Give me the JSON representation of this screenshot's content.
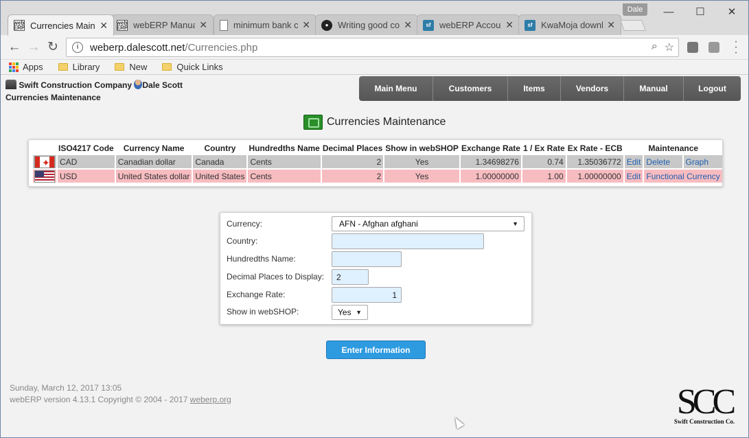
{
  "browser": {
    "tabs": [
      {
        "label": "Currencies Main",
        "icon": "weberp-icon",
        "active": true
      },
      {
        "label": "webERP Manual",
        "icon": "weberp-icon",
        "active": false
      },
      {
        "label": "minimum bank c",
        "icon": "document-icon",
        "active": false
      },
      {
        "label": "Writing good co",
        "icon": "github-icon",
        "active": false
      },
      {
        "label": "webERP Accoun",
        "icon": "sourceforge-icon",
        "active": false
      },
      {
        "label": "KwaMoja downl",
        "icon": "sourceforge-icon",
        "active": false
      }
    ],
    "profile_name": "Dale",
    "url_host": "weberp.dalescott.net",
    "url_path": "/Currencies.php",
    "bookmarks": [
      {
        "label": "Apps",
        "icon": "apps-grid-icon"
      },
      {
        "label": "Library",
        "icon": "folder-icon"
      },
      {
        "label": "New",
        "icon": "folder-icon"
      },
      {
        "label": "Quick Links",
        "icon": "folder-icon"
      }
    ]
  },
  "header": {
    "company": "Swift Construction Company",
    "user": "Dale Scott",
    "section": "Currencies Maintenance"
  },
  "nav": [
    {
      "label": "Main Menu"
    },
    {
      "label": "Customers"
    },
    {
      "label": "Items"
    },
    {
      "label": "Vendors"
    },
    {
      "label": "Manual"
    },
    {
      "label": "Logout"
    }
  ],
  "page_title": "Currencies Maintenance",
  "table": {
    "headers": {
      "code": "ISO4217 Code",
      "name": "Currency Name",
      "country": "Country",
      "hundredths": "Hundredths Name",
      "decimals": "Decimal Places",
      "webshop": "Show in webSHOP",
      "rate": "Exchange Rate",
      "inverse": "1 / Ex Rate",
      "ecb": "Ex Rate - ECB",
      "maintenance": "Maintenance"
    },
    "rows": [
      {
        "flag": "canada-flag",
        "code": "CAD",
        "name": "Canadian dollar",
        "country": "Canada",
        "hundredths": "Cents",
        "decimals": "2",
        "webshop": "Yes",
        "rate": "1.34698276",
        "inverse": "0.74",
        "ecb": "1.35036772",
        "edit": "Edit",
        "delete": "Delete",
        "graph": "Graph"
      },
      {
        "flag": "us-flag",
        "code": "USD",
        "name": "United States dollar",
        "country": "United States",
        "hundredths": "Cents",
        "decimals": "2",
        "webshop": "Yes",
        "rate": "1.00000000",
        "inverse": "1.00",
        "ecb": "1.00000000",
        "edit": "Edit",
        "functional": "Functional Currency"
      }
    ]
  },
  "form": {
    "currency_label": "Currency:",
    "currency_value": "AFN - Afghan afghani",
    "country_label": "Country:",
    "country_value": "",
    "hundredths_label": "Hundredths Name:",
    "hundredths_value": "",
    "decimals_label": "Decimal Places to Display:",
    "decimals_value": "2",
    "rate_label": "Exchange Rate:",
    "rate_value": "1",
    "webshop_label": "Show in webSHOP:",
    "webshop_value": "Yes",
    "submit_label": "Enter Information"
  },
  "footer": {
    "date": "Sunday, March 12, 2017 13:05",
    "version": "webERP version 4.13.1 Copyright © 2004 - 2017",
    "link": "weberp.org"
  },
  "logo": {
    "big": "SCC",
    "small": "Swift Construction Co."
  },
  "colors": {
    "nav_bg": "#5f5f5f",
    "row_cad": "#c8c8c8",
    "row_usd": "#f7bcc0",
    "button": "#2e9be0",
    "input_bg": "#dff0ff",
    "link": "#1f5fb0"
  }
}
